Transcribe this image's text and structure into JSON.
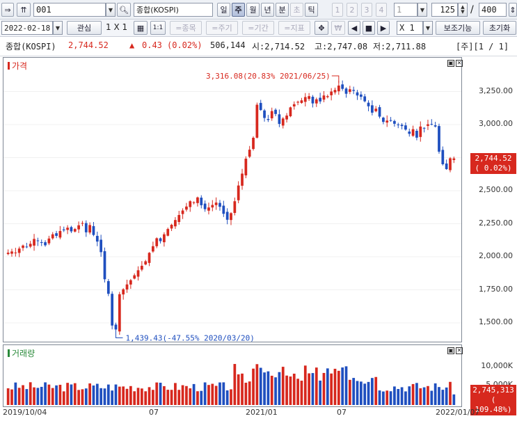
{
  "toolbar1": {
    "code": "001",
    "name": "종합(KOSPI)",
    "periods": [
      "일",
      "주",
      "월",
      "년",
      "분",
      "초",
      "틱"
    ],
    "period_active": "주",
    "nums": [
      "1",
      "2",
      "3",
      "4"
    ],
    "num_field": "1",
    "count": "125",
    "slash": "/",
    "total": "400"
  },
  "toolbar2": {
    "date": "2022-02-18",
    "interest": "관심",
    "grid": "1 X 1",
    "one_one": "1:1",
    "items": [
      "=종목",
      "=주기",
      "=기간",
      "=지표"
    ],
    "won_icon": "₩",
    "ratio": "X 1",
    "aux": "보조기능",
    "reset": "초기화"
  },
  "info": {
    "name": "종합(KOSPI)",
    "price": "2,744.52",
    "arrow": "▲",
    "change": "0.43",
    "change_pct": "(0.02%)",
    "volume": "506,144",
    "open": "시:2,714.52",
    "high": "고:2,747.08",
    "low": "저:2,711.88",
    "page": "[주][1 / 1]"
  },
  "price_panel": {
    "title": "가격",
    "high_label": "3,316.08(20.83% 2021/06/25)",
    "low_label": "1,439.43(-47.55% 2020/03/20)",
    "ticks": [
      "3,250.00",
      "3,000.00",
      "2,750.00",
      "2,500.00",
      "2,250.00",
      "2,000.00",
      "1,750.00",
      "1,500.00"
    ],
    "badge_value": "2,744.52",
    "badge_pct": "( 0.02%)"
  },
  "volume_panel": {
    "title": "거래량",
    "ticks": [
      "10,000K",
      "5,000K"
    ],
    "badge_value": "2,745,313",
    "badge_pct": "( 109.48%)"
  },
  "x_labels": [
    "2019/10/04",
    "07",
    "2021/01",
    "07",
    "2022/01/07"
  ],
  "colors": {
    "up": "#d7281e",
    "down": "#1f4fbf",
    "accent": "#5e6f95"
  },
  "chart_data": {
    "type": "candlestick",
    "y_range": [
      1400,
      3400
    ],
    "volume_range": [
      0,
      13000
    ],
    "closes": [
      2031,
      2040,
      2032,
      2062,
      2085,
      2075,
      2098,
      2135,
      2120,
      2105,
      2087,
      2138,
      2170,
      2158,
      2195,
      2200,
      2220,
      2192,
      2210,
      2238,
      2255,
      2185,
      2240,
      2165,
      2115,
      2035,
      1830,
      1720,
      1480,
      1450,
      1717,
      1754,
      1791,
      1823,
      1860,
      1898,
      1932,
      1966,
      2030,
      2080,
      2140,
      2118,
      2170,
      2210,
      2242,
      2278,
      2316,
      2350,
      2380,
      2420,
      2412,
      2449,
      2390,
      2360,
      2373,
      2392,
      2410,
      2378,
      2325,
      2280,
      2330,
      2420,
      2539,
      2629,
      2742,
      2810,
      2900,
      3150,
      3110,
      3050,
      3035,
      3102,
      3080,
      3005,
      3046,
      3068,
      3130,
      3154,
      3172,
      3183,
      3208,
      3215,
      3160,
      3191,
      3175,
      3220,
      3215,
      3250,
      3262,
      3295,
      3270,
      3233,
      3267,
      3255,
      3220,
      3210,
      3176,
      3138,
      3090,
      3120,
      3060,
      3020,
      3030,
      3028,
      3006,
      2996,
      2989,
      2962,
      2930,
      2965,
      2901,
      2985,
      2975,
      3002,
      3000,
      2985,
      2795,
      2700,
      2663,
      2745,
      2744
    ]
  }
}
